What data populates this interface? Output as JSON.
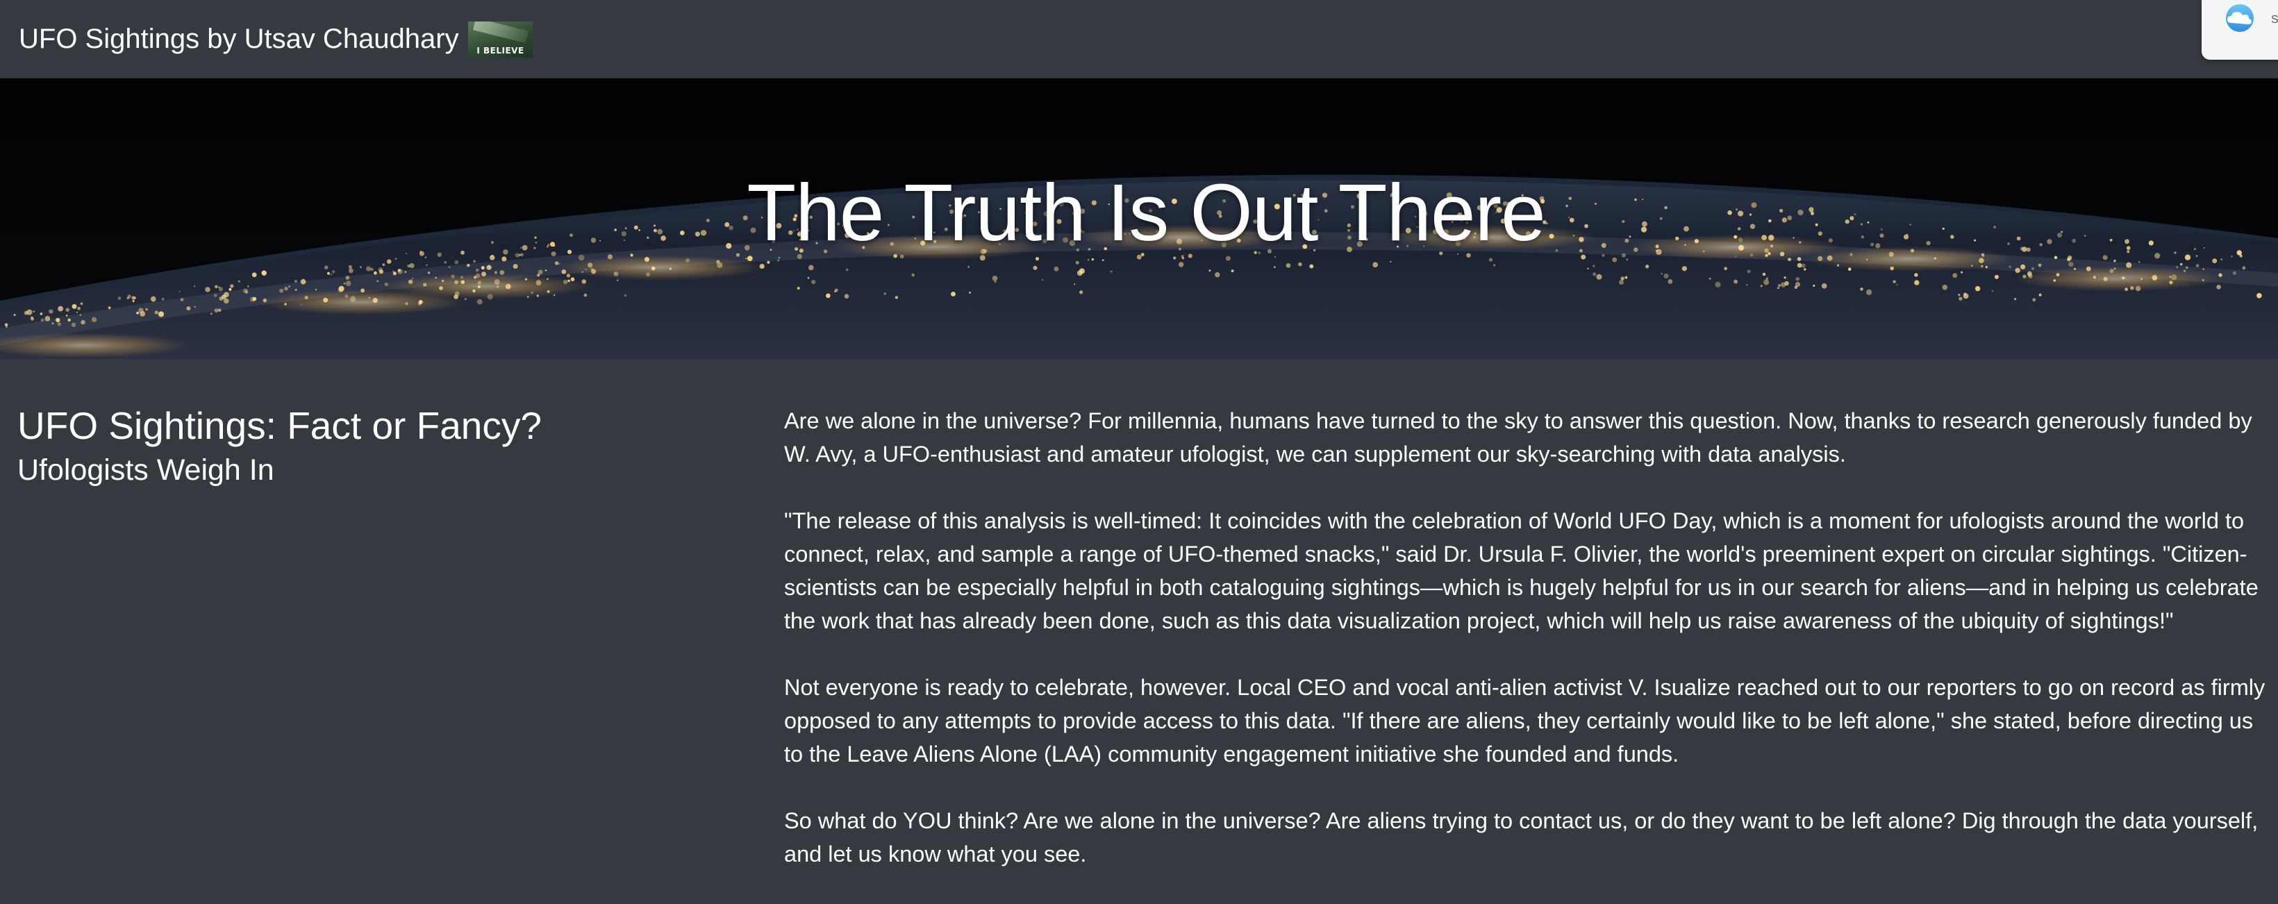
{
  "navbar": {
    "brand": "UFO Sightings by Utsav Chaudhary",
    "logo_text": "I BELIEVE",
    "widget_icon": "cloud-icon"
  },
  "hero": {
    "title": "The Truth Is Out There"
  },
  "article": {
    "heading": "UFO Sightings: Fact or Fancy?",
    "subheading": "Ufologists Weigh In",
    "paragraphs": [
      "Are we alone in the universe? For millennia, humans have turned to the sky to answer this question. Now, thanks to research generously funded by W. Avy, a UFO-enthusiast and amateur ufologist, we can supplement our sky-searching with data analysis.",
      "\"The release of this analysis is well-timed: It coincides with the celebration of World UFO Day, which is a moment for ufologists around the world to connect, relax, and sample a range of UFO-themed snacks,\" said Dr. Ursula F. Olivier, the world's preeminent expert on circular sightings. \"Citizen-scientists can be especially helpful in both cataloguing sightings—which is hugely helpful for us in our search for aliens—and in helping us celebrate the work that has already been done, such as this data visualization project, which will help us raise awareness of the ubiquity of sightings!\"",
      "Not everyone is ready to celebrate, however. Local CEO and vocal anti-alien activist V. Isualize reached out to our reporters to go on record as firmly opposed to any attempts to provide access to this data. \"If there are aliens, they certainly would like to be left alone,\" she stated, before directing us to the Leave Aliens Alone (LAA) community engagement initiative she founded and funds.",
      "So what do YOU think? Are we alone in the universe? Are aliens trying to contact us, or do they want to be left alone? Dig through the data yourself, and let us know what you see."
    ]
  },
  "colors": {
    "background": "#343a40",
    "text": "#ffffff",
    "city_lights": "#ffd98a"
  }
}
